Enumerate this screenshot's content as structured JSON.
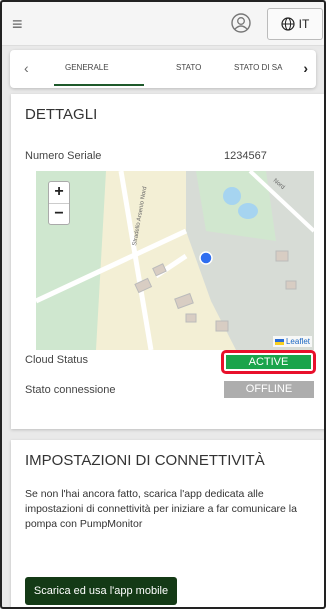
{
  "header": {
    "menu_icon": "hamburger-icon",
    "user_icon": "user-circle-icon",
    "language": {
      "icon": "globe-icon",
      "label": "IT"
    }
  },
  "tabs": {
    "items": [
      {
        "label": "GENERALE",
        "active": true
      },
      {
        "label": "STATO",
        "active": false
      },
      {
        "label": "STATO DI SA",
        "active": false
      }
    ],
    "prev_icon": "chevron-left-icon",
    "next_icon": "chevron-right-icon"
  },
  "details": {
    "title": "DETTAGLI",
    "serial_label": "Numero Seriale",
    "serial_value": "1234567",
    "map": {
      "zoom_in": "+",
      "zoom_out": "−",
      "attribution": "Leaflet",
      "street_labels": [
        "Stradello Arsenio Nord",
        "Nord"
      ]
    },
    "cloud_status_label": "Cloud Status",
    "cloud_status_value": "ACTIVE",
    "connection_label": "Stato connessione",
    "connection_value": "OFFLINE"
  },
  "connectivity": {
    "title": "IMPOSTAZIONI DI CONNETTIVITÀ",
    "text": "Se non l'hai ancora fatto, scarica l'app dedicata alle impostazioni di connettività per iniziare a far comunicare la pompa con PumpMonitor",
    "button_label": "Scarica ed usa l'app mobile"
  },
  "colors": {
    "accent": "#1e5a2b",
    "active": "#1aa44b",
    "offline": "#adadad",
    "highlight": "#e8102b",
    "button": "#143a16"
  }
}
